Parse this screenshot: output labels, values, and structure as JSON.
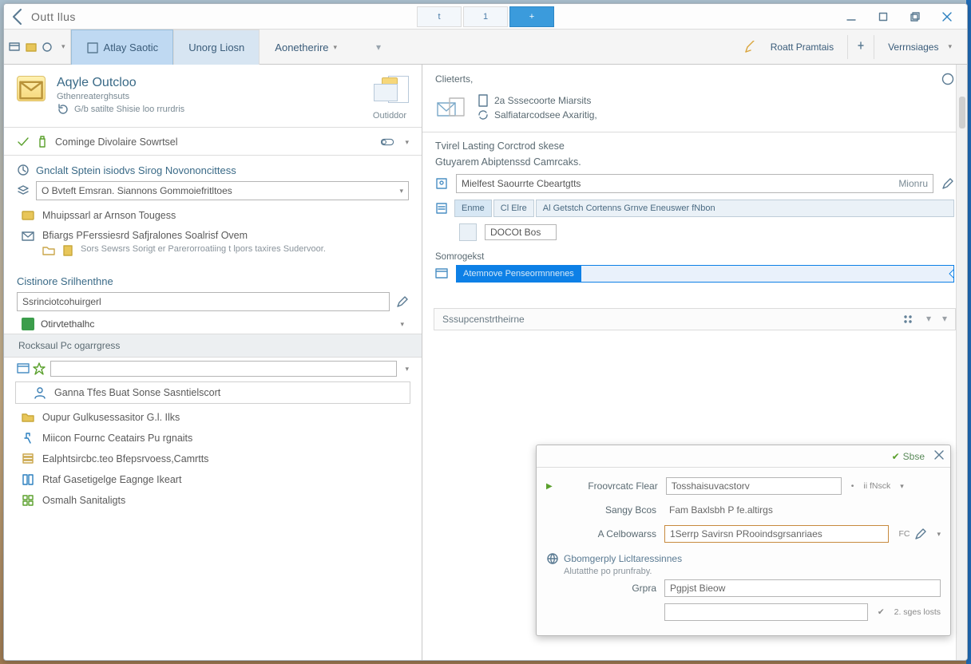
{
  "titlebar": {
    "title": "Outt llus",
    "center_tabs": [
      "t",
      "1",
      "+"
    ]
  },
  "ribbon": {
    "tabs": [
      {
        "label": "Atlay Saotic",
        "state": "active"
      },
      {
        "label": "Unorg Liosn",
        "state": "hover"
      },
      {
        "label": "Aonetherire",
        "state": "plain"
      }
    ],
    "right": {
      "recent": "Roatt Pramtais",
      "view": "Verrnsiages"
    }
  },
  "left": {
    "header": {
      "title": "Aqyle Outcloo",
      "sub1": "Gthenreaterghsuts",
      "sub2": "G/b satilte Shisie loo rrurdris",
      "right_label": "Outiddor"
    },
    "check_row": "Cominge  Divolaire Sowrtsel",
    "group1": {
      "title": "Gnclalt Sptein isiodvs Sirog Novononcittess",
      "input": "O Bvteft Emsran. Siannons Gommoiefritltoes",
      "item1": "Mhuipssarl ar Arnson Tougess",
      "item2": "Bfiargs PFerssiesrd Safjralones Soalrisf Ovem",
      "item2_sub": "Sors Sewsrs Sorigt er Parerorroatiing t lpors taxires Sudervoor."
    },
    "group2": {
      "title": "Cistinore Srilhenthne",
      "input": "Ssrinciotcohuirgerl",
      "category": "Otirvtethalhc"
    },
    "group3": {
      "title": "Rocksaul Pc ogarrgress",
      "search": "",
      "item_selected": "Ganna Tfes Buat Sonse Sasntielscort",
      "items": [
        "Oupur Gulkusessasitor G.l. Ilks",
        "Miicon Fournc Ceatairs Pu rgnaits",
        "Ealphtsircbc.teo Bfepsrvoess,Camrtts",
        "Rtaf Gasetigelge Eagnge Ikeart",
        "Osmalh Sanitaligts"
      ]
    }
  },
  "right": {
    "header": "Clieterts,",
    "sub1": "2a Sssecoorte Miarsits",
    "sub2": "Salfiatarcodsee Axaritig,",
    "section1": "Tvirel Lasting Corctrod skese",
    "section2": "Gtuyarem Abiptenssd Camrcaks.",
    "search_placeholder": "Mielfest Saourrte Cbeartgtts",
    "search_right": "Mionru",
    "chips": [
      "Enme",
      "Cl Elre",
      "Al Getstch Cortenns Grnve Eneuswer fNbon"
    ],
    "box_text": "DOCOt Bos",
    "progress_label": "Somrogekst",
    "progress_text": "Atemnove Penseormnnenes",
    "accordion": "Sssupcenstrtheirne"
  },
  "floatpanel": {
    "save": "Sbse",
    "rows": [
      {
        "k": "Froovrcatc Flear",
        "v": "Tosshaisuvacstorv",
        "extra": "ii fNsck"
      },
      {
        "k": "Sangy Bcos",
        "v": "Fam Baxlsbh P fe.altirgs"
      },
      {
        "k": "A Celbowarss",
        "v": "1Serrp Savirsn PRooindsgrsanriaes",
        "extra": "FC",
        "hl": true
      }
    ],
    "group_label": "Gbomgerply Licltaressinnes",
    "group_sub": "Alutatthe po prunfraby.",
    "row4": {
      "k": "Grpra",
      "v": "Pgpjst Bieow"
    },
    "row5_extra": "2. sges losts"
  }
}
